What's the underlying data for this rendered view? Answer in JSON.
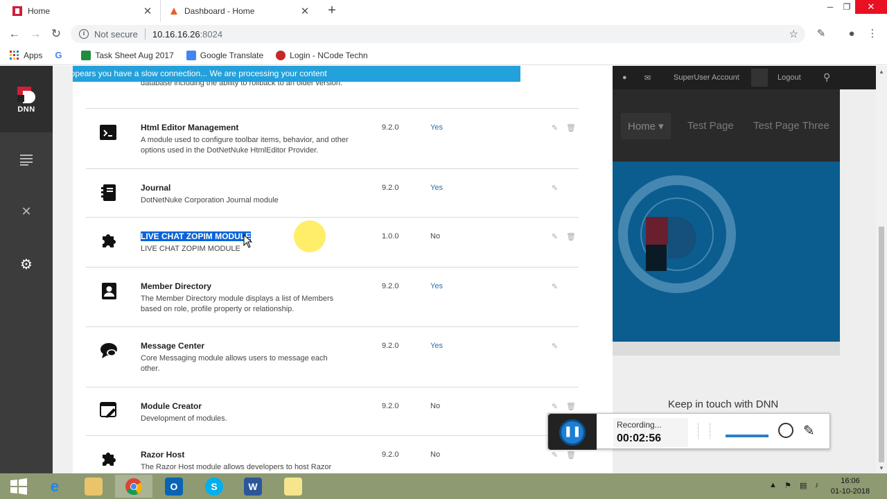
{
  "browser": {
    "tabs": [
      {
        "title": "Home",
        "active": true
      },
      {
        "title": "Dashboard - Home",
        "active": false
      }
    ],
    "new_tab": "+",
    "url_security": "Not secure",
    "url_host": "10.16.16.26",
    "url_port": ":8024",
    "bookmarks": [
      {
        "label": "Apps"
      },
      {
        "label": ""
      },
      {
        "label": "Task Sheet Aug 2017"
      },
      {
        "label": "Google Translate"
      },
      {
        "label": "Login - NCode Techn"
      }
    ]
  },
  "persona_bar": {
    "logo_text": "DNN",
    "items": [
      "content-icon",
      "tools-icon",
      "settings-icon"
    ]
  },
  "panel": {
    "slow_connection": "It appears you have a slow connection... We are processing your content",
    "cut_description": "database including the ability to rollback to an older version.",
    "modules": [
      {
        "icon": "terminal-icon",
        "name": "Html Editor Management",
        "description": "A module used to configure toolbar items, behavior, and other options used in the DotNetNuke HtmlEditor Provider.",
        "version": "9.2.0",
        "premium": "Yes",
        "deletable": true
      },
      {
        "icon": "journal-icon",
        "name": "Journal",
        "description": "DotNetNuke Corporation Journal module",
        "version": "9.2.0",
        "premium": "Yes",
        "deletable": false
      },
      {
        "icon": "puzzle-icon",
        "name": "LIVE CHAT ZOPIM MODULE",
        "description": "LIVE CHAT ZOPIM MODULE",
        "version": "1.0.0",
        "premium": "No",
        "deletable": true
      },
      {
        "icon": "member-directory-icon",
        "name": "Member Directory",
        "description": "The Member Directory module displays a list of Members based on role, profile property or relationship.",
        "version": "9.2.0",
        "premium": "Yes",
        "deletable": false
      },
      {
        "icon": "message-center-icon",
        "name": "Message Center",
        "description": "Core Messaging module allows users to message each other.",
        "version": "9.2.0",
        "premium": "Yes",
        "deletable": false
      },
      {
        "icon": "module-creator-icon",
        "name": "Module Creator",
        "description": "Development of modules.",
        "version": "9.2.0",
        "premium": "No",
        "deletable": true
      },
      {
        "icon": "puzzle-icon",
        "name": "Razor Host",
        "description": "The Razor Host module allows developers to host Razor",
        "version": "9.2.0",
        "premium": "No",
        "deletable": true
      }
    ]
  },
  "site": {
    "account": "SuperUser Account",
    "logout": "Logout",
    "menu": [
      "Home",
      "Test Page",
      "Test Page Three"
    ],
    "keep_in_touch": "Keep in touch with DNN"
  },
  "recorder": {
    "status": "Recording...",
    "time": "00:02:56"
  },
  "taskbar": {
    "time": "16:06",
    "date": "01-10-2018"
  },
  "colors": {
    "accent": "#23a1db",
    "premium_yes": "#2a6fb0",
    "persona_bg": "#3c3c3c",
    "dnn_red": "#ce1f36"
  }
}
